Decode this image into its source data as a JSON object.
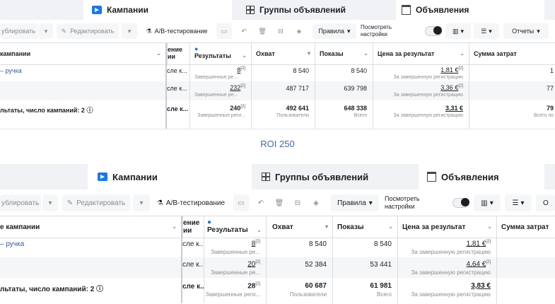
{
  "tabs": {
    "campaigns": "Кампании",
    "adsets": "Группы объявлений",
    "ads": "Объявления"
  },
  "toolbar": {
    "duplicate": "ублировать",
    "edit": "Редактировать",
    "ab_test": "А/В-тестирование",
    "rules": "Правила",
    "view_settings_1": "Посмотреть",
    "view_settings_2": "настройки",
    "reports": "Отчеты",
    "reports_cut": "О"
  },
  "columns": {
    "name": "кампании",
    "name_2": "е кампании",
    "delivery_1": "ение",
    "delivery_2": "ии",
    "results": "Результаты",
    "reach": "Охват",
    "impressions": "Показы",
    "cpr": "Цена за результат",
    "spend": "Сумма затрат"
  },
  "caption": "ROI 250",
  "panels": [
    {
      "rows": [
        {
          "name": "– ручка",
          "delivery": "сле к...",
          "results": "8",
          "results_sub": "Завершенные ре...",
          "reach": "8 540",
          "impressions": "8 540",
          "cpr": "1,81 €",
          "cpr_sub": "За завершенную регистрацию",
          "spend": "1"
        },
        {
          "name": "",
          "delivery": "сле к...",
          "results": "232",
          "results_sub": "Завершенные ре...",
          "reach": "487 717",
          "impressions": "639 798",
          "cpr": "3,36 €",
          "cpr_sub": "За завершенную регистрацию",
          "spend": "77"
        }
      ],
      "total": {
        "name": "льтаты, число кампаний: 2",
        "delivery": "сле к...",
        "results": "240",
        "results_sub": "Завершенные реги...",
        "reach": "492 641",
        "reach_sub": "Пользователи",
        "impressions": "648 338",
        "impressions_sub": "Всего",
        "cpr": "3,31 €",
        "cpr_sub": "За завершенную регистрацию",
        "spend": "79",
        "spend_sub": "Всего по"
      }
    },
    {
      "rows": [
        {
          "name": "– ручка",
          "delivery": "сле к...",
          "results": "8",
          "results_sub": "Завершенные ре...",
          "reach": "8 540",
          "impressions": "8 540",
          "cpr": "1,81 €",
          "cpr_sub": "За завершенную регистрацию"
        },
        {
          "name": "",
          "delivery": "сле к...",
          "results": "20",
          "results_sub": "Завершенные ре...",
          "reach": "52 384",
          "impressions": "53 441",
          "cpr": "4,64 €",
          "cpr_sub": "За завершенную регистрацию"
        }
      ],
      "total": {
        "name": "льтаты, число кампаний: 2",
        "delivery": "сле к...",
        "results": "28",
        "results_sub": "Завершенные реги...",
        "reach": "60 687",
        "reach_sub": "Пользователи",
        "impressions": "61 981",
        "impressions_sub": "Всего",
        "cpr": "3,83 €",
        "cpr_sub": "За завершенную регистрацию"
      }
    }
  ],
  "footnote_mark": "[2]",
  "info_mark": "ⓘ"
}
